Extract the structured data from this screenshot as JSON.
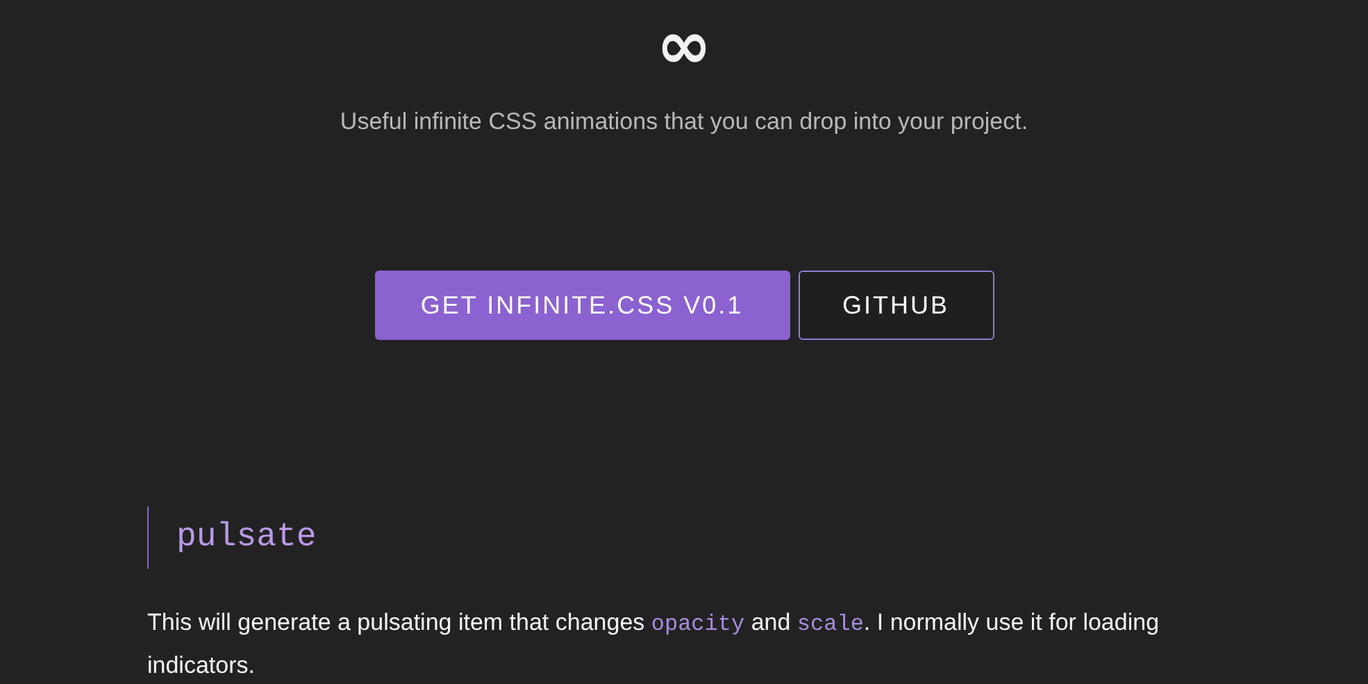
{
  "logo": "∞",
  "tagline": "Useful infinite CSS animations that you can drop into your project.",
  "buttons": [
    {
      "label": "GET INFINITE.CSS V0.1",
      "kind": "primary"
    },
    {
      "label": "GITHUB",
      "kind": "outline"
    }
  ],
  "section": {
    "heading": "pulsate",
    "paragraph": [
      {
        "kind": "text",
        "text": "This will generate a pulsating item that changes "
      },
      {
        "kind": "code",
        "text": "opacity"
      },
      {
        "kind": "text",
        "text": " and "
      },
      {
        "kind": "code",
        "text": "scale"
      },
      {
        "kind": "text",
        "text": ". I normally use it for loading indicators."
      }
    ]
  }
}
